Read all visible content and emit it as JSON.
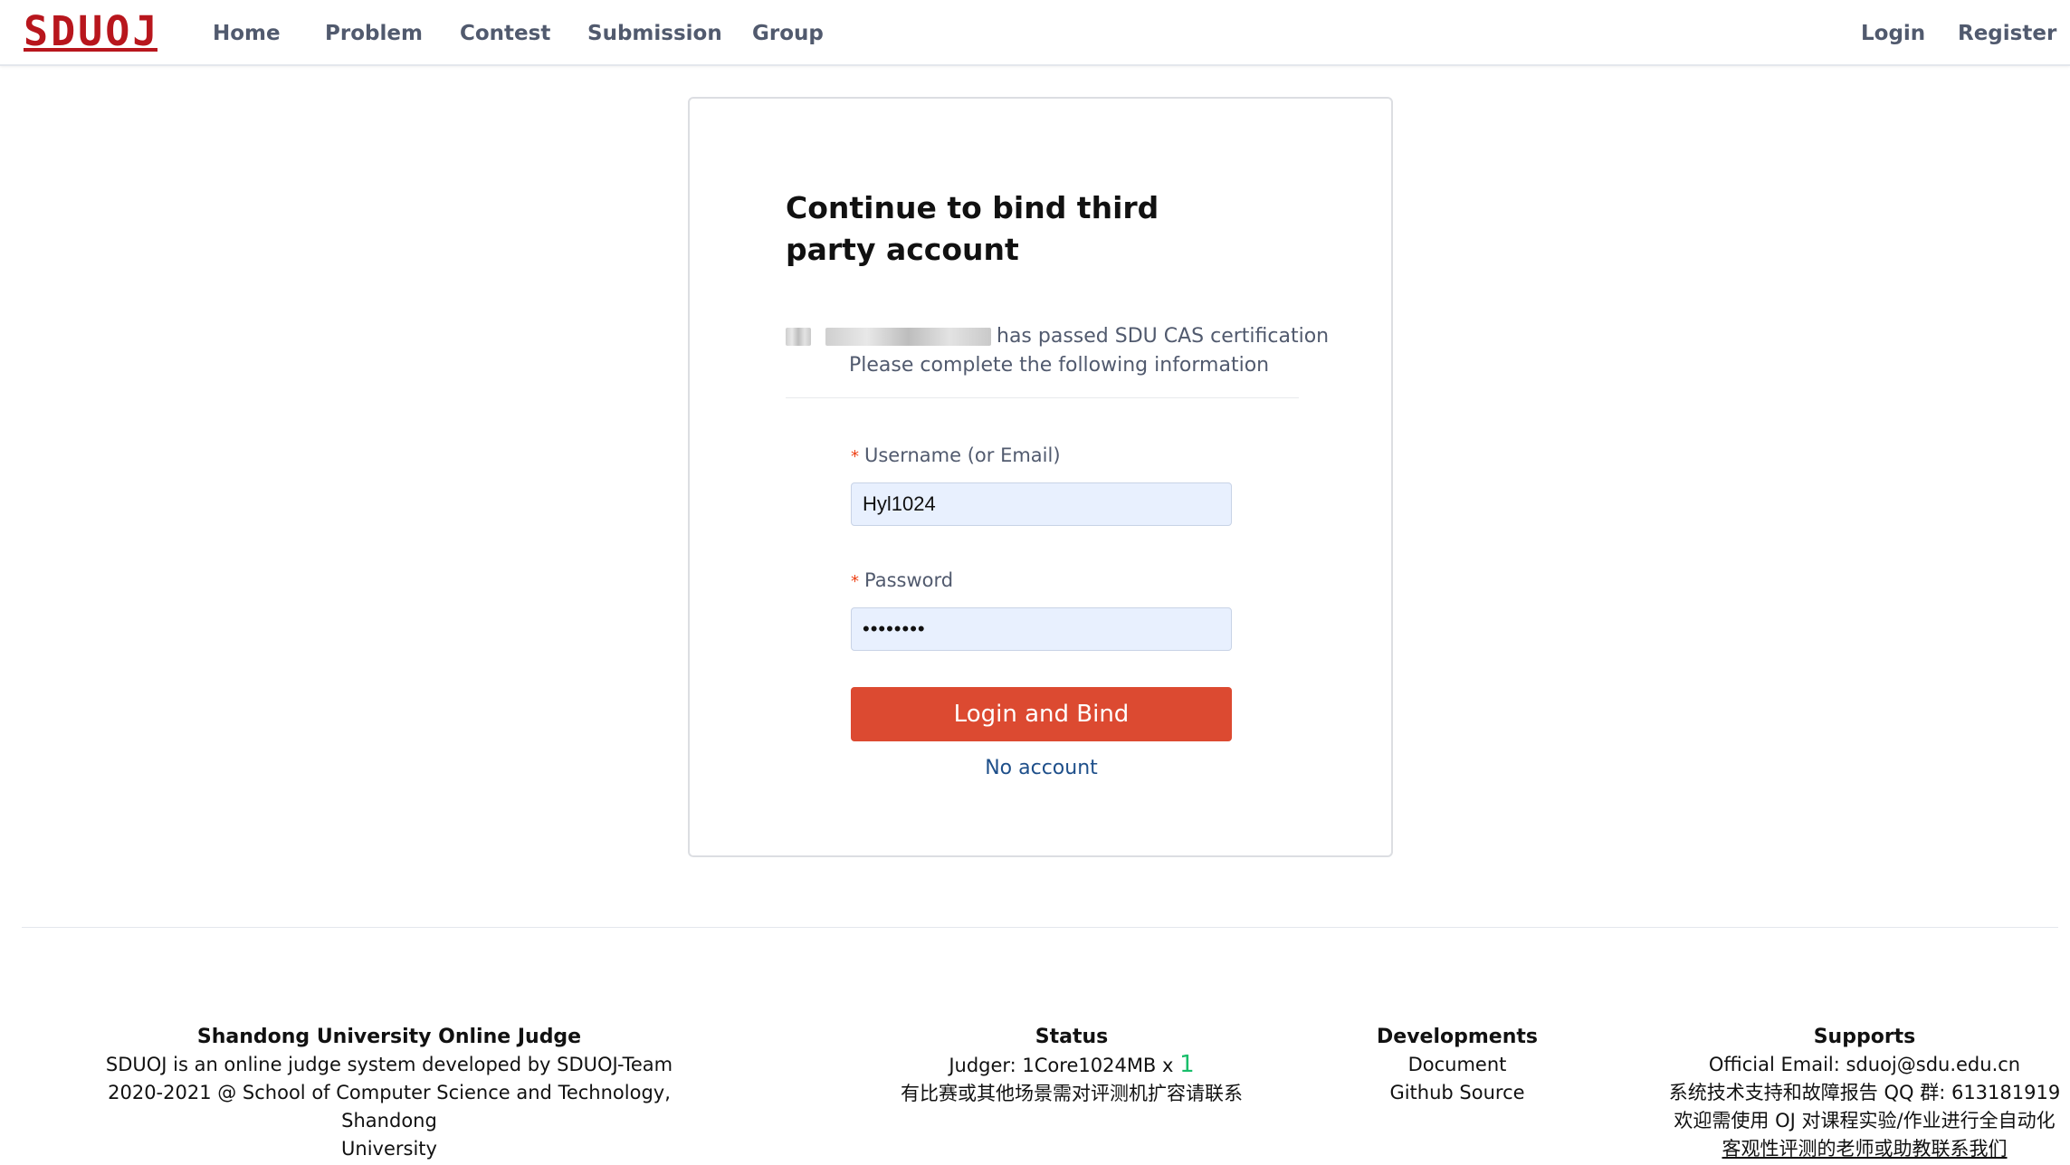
{
  "nav": {
    "logo": "SDUOJ",
    "items": [
      "Home",
      "Problem",
      "Contest",
      "Submission",
      "Group"
    ],
    "login": "Login",
    "register": "Register"
  },
  "card": {
    "title": "Continue to bind third party account",
    "cert_text": "has passed SDU CAS certification",
    "cert_sub": "Please complete the following information",
    "username_label": "Username (or Email)",
    "username_value": "Hyl1024",
    "password_label": "Password",
    "password_value": "••••••••",
    "submit_label": "Login and Bind",
    "no_account": "No account"
  },
  "footer": {
    "about": {
      "heading": "Shandong University Online Judge",
      "line1": "SDUOJ is an online judge system developed by SDUOJ-Team",
      "line2": "2020-2021 @ School of Computer Science and Technology, Shandong",
      "line3": "University"
    },
    "status": {
      "heading": "Status",
      "judger_label": "Judger: 1Core1024MB x",
      "judger_count": "1",
      "note": "有比赛或其他场景需对评测机扩容请联系"
    },
    "developments": {
      "heading": "Developments",
      "document": "Document",
      "github": "Github Source"
    },
    "supports": {
      "heading": "Supports",
      "email": "Official Email: sduoj@sdu.edu.cn",
      "qq": "系统技术支持和故障报告 QQ 群: 613181919",
      "line3": "欢迎需使用 OJ 对课程实验/作业进行全自动化",
      "line4": "客观性评测的老师或助教联系我们"
    }
  }
}
